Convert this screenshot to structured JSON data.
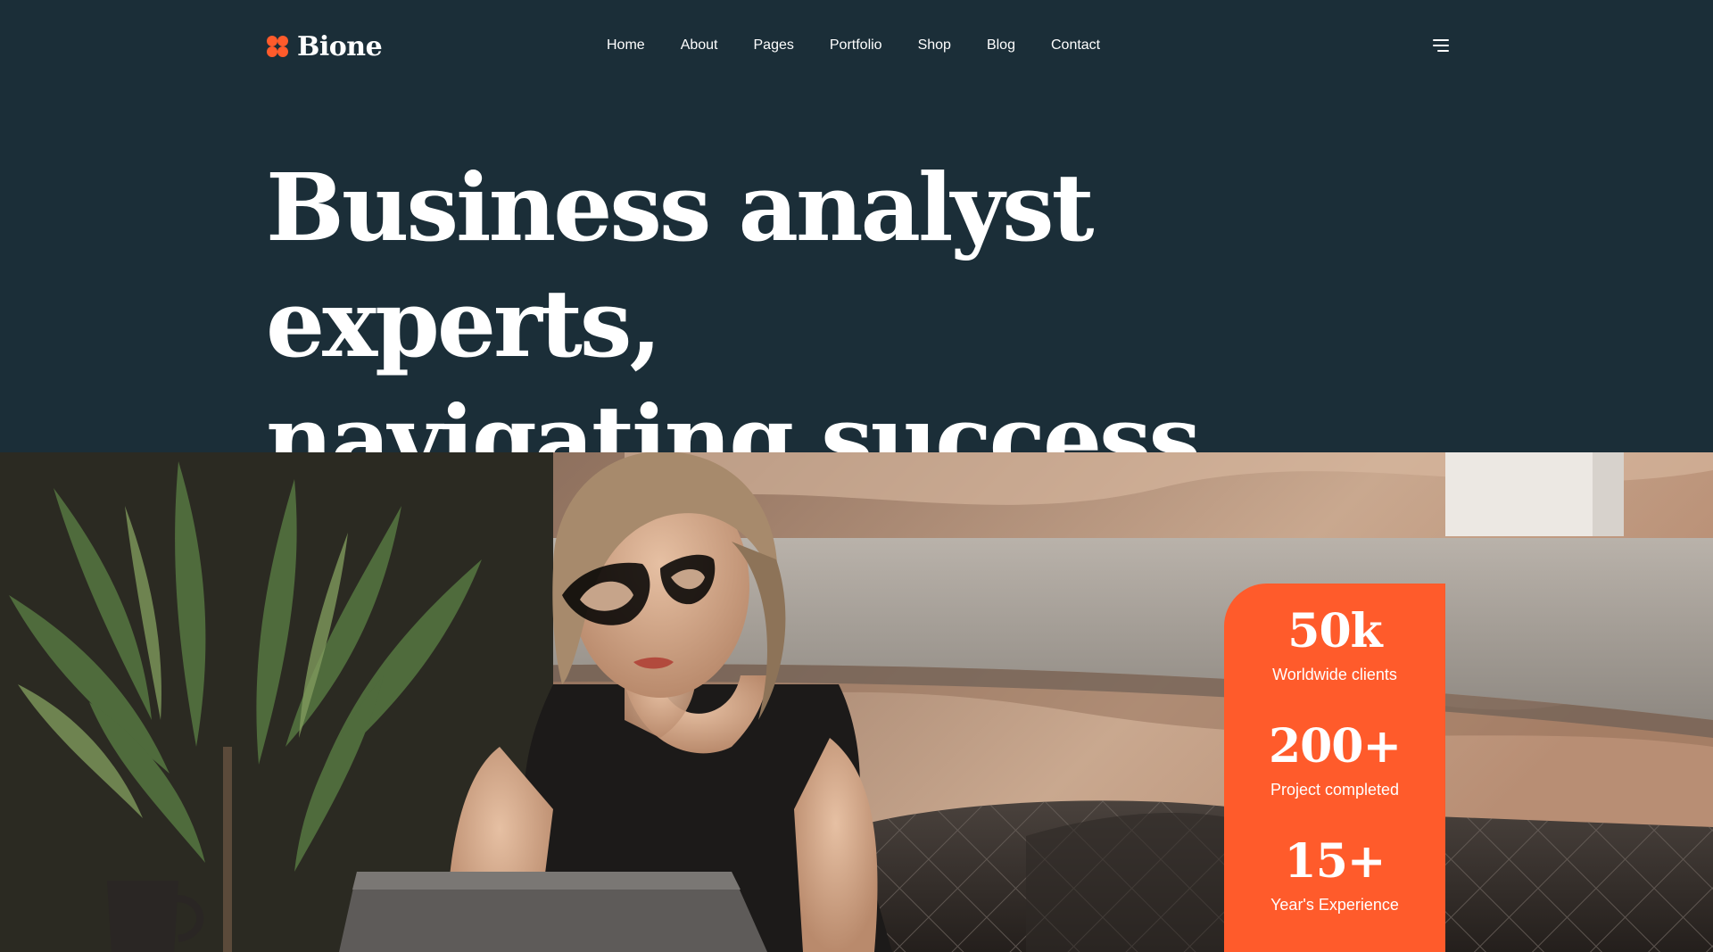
{
  "brand": {
    "name": "Bione",
    "logo_icon": "clover-icon",
    "accent": "#ff5b2b"
  },
  "nav": {
    "items": [
      {
        "label": "Home"
      },
      {
        "label": "About"
      },
      {
        "label": "Pages"
      },
      {
        "label": "Portfolio"
      },
      {
        "label": "Shop"
      },
      {
        "label": "Blog"
      },
      {
        "label": "Contact"
      }
    ],
    "menu_icon": "hamburger-menu-icon"
  },
  "hero": {
    "title_line1": "Business analyst experts,",
    "title_line2": "navigating success",
    "background": "#1b2e38"
  },
  "stats": [
    {
      "value": "50k",
      "label": "Worldwide clients"
    },
    {
      "value": "200+",
      "label": "Project completed"
    },
    {
      "value": "15+",
      "label": "Year's Experience"
    }
  ]
}
